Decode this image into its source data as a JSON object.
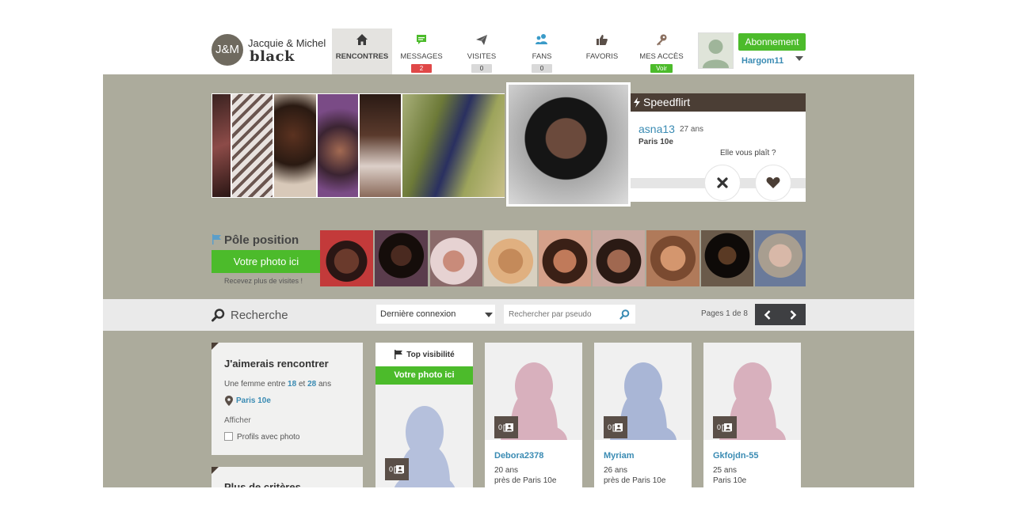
{
  "header": {
    "logo_initials": "J&M",
    "logo_line1": "Jacquie & Michel",
    "logo_line2": "black",
    "nav": [
      {
        "label": "RENCONTRES",
        "icon": "home-icon"
      },
      {
        "label": "MESSAGES",
        "icon": "chat-icon",
        "badge": "2",
        "badge_color": "#e04848"
      },
      {
        "label": "VISITES",
        "icon": "paper-plane-icon",
        "badge": "0",
        "badge_color": "#d9d9d9"
      },
      {
        "label": "FANS",
        "icon": "users-icon",
        "badge": "0",
        "badge_color": "#d9d9d9"
      },
      {
        "label": "FAVORIS",
        "icon": "thumbs-up-icon"
      },
      {
        "label": "MES ACCÈS",
        "icon": "key-icon",
        "badge": "Voir",
        "badge_color": "#4cbb2b"
      }
    ],
    "subscribe_label": "Abonnement",
    "username": "Hargom11"
  },
  "speedflirt": {
    "title": "Speedflirt",
    "name": "asna13",
    "age": "27 ans",
    "city": "Paris 10e",
    "question": "Elle vous plaît ?"
  },
  "pole": {
    "title": "Pôle position",
    "button": "Votre photo ici",
    "subtitle": "Recevez plus de visites !"
  },
  "search": {
    "title": "Recherche",
    "sort_selected": "Dernière connexion",
    "pseudo_placeholder": "Rechercher par pseudo",
    "pages": "Pages 1 de 8"
  },
  "filter_panel": {
    "title": "J'aimerais rencontrer",
    "line_prefix": "Une femme entre",
    "age_min": "18",
    "line_mid": "et",
    "age_max": "28",
    "line_suffix": "ans",
    "city": "Paris 10e",
    "show_label": "Afficher",
    "photo_only_label": "Profils avec photo",
    "more_title": "Plus de critères"
  },
  "top_visibility": {
    "title": "Top visibilité",
    "button": "Votre photo ici",
    "photo_count": "0"
  },
  "profiles": [
    {
      "name": "Debora2378",
      "age": "20 ans",
      "city": "près de Paris 10e",
      "photo_count": "0",
      "silhouette_color": "#d8b0bd"
    },
    {
      "name": "Myriam",
      "age": "26 ans",
      "city": "près de Paris 10e",
      "photo_count": "0",
      "silhouette_color": "#a9b6d6"
    },
    {
      "name": "Gkfojdn-55",
      "age": "25 ans",
      "city": "Paris 10e",
      "photo_count": "0",
      "silhouette_color": "#d8b0bd"
    }
  ]
}
